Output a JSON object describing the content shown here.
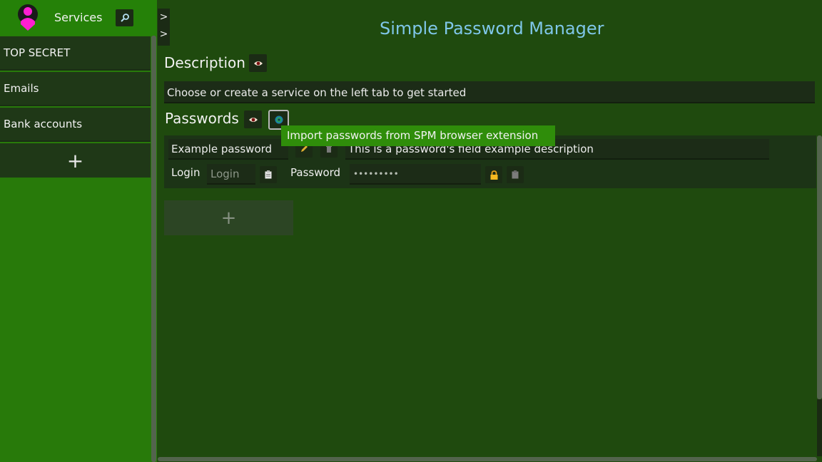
{
  "app": {
    "title": "Simple Password Manager"
  },
  "sidebar": {
    "header": {
      "title": "Services",
      "avatar_icon": "user-avatar-icon",
      "search_icon": "magnifier-icon"
    },
    "items": [
      {
        "label": "TOP SECRET"
      },
      {
        "label": "Emails"
      },
      {
        "label": "Bank accounts"
      }
    ],
    "add_label": "+"
  },
  "toggle": {
    "line1": ">",
    "line2": ">"
  },
  "description": {
    "heading": "Description",
    "value": "Choose or create a service on the left tab to get started",
    "visibility_icon": "eye-icon"
  },
  "passwords": {
    "heading": "Passwords",
    "visibility_icon": "eye-icon",
    "import_icon": "extension-icon",
    "tooltip": "Import passwords from SPM browser extension",
    "entry": {
      "name": "Example password",
      "description": "This is a password's field example description",
      "login_label": "Login",
      "login_placeholder": "Login",
      "password_label": "Password",
      "password_value": "•••••••••",
      "lock_icon": "lock-icon",
      "copy_icon": "clipboard-icon"
    },
    "add_label": "+"
  },
  "colors": {
    "sidebar_bg": "#287a0a",
    "main_bg": "#1f4a0e",
    "title_accent": "#7fc6e8",
    "tooltip_bg": "#2f8d0a",
    "avatar": "#ff1fd2"
  }
}
